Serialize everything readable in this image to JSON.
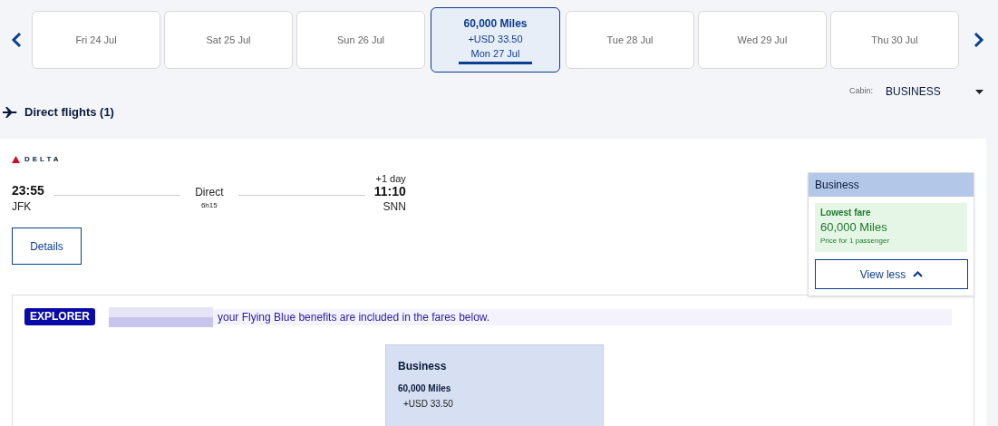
{
  "date_strip": [
    {
      "label": "Fri 24 Jul",
      "selected": false
    },
    {
      "label": "Sat 25 Jul",
      "selected": false
    },
    {
      "label": "Sun 26 Jul",
      "selected": false
    },
    {
      "label": "Mon 27 Jul",
      "price": "60,000 Miles",
      "tax": "+USD 33.50",
      "selected": true
    },
    {
      "label": "Tue 28 Jul",
      "selected": false
    },
    {
      "label": "Wed 29 Jul",
      "selected": false
    },
    {
      "label": "Thu 30 Jul",
      "selected": false
    }
  ],
  "cabin": {
    "label": "Cabin:",
    "value": "BUSINESS"
  },
  "section_title": "Direct flights (1)",
  "flight": {
    "airline": "DELTA",
    "departure_time": "23:55",
    "departure_airport": "JFK",
    "stops": "Direct",
    "duration": "6h15",
    "day_offset": "+1 day",
    "arrival_time": "11:10",
    "arrival_airport": "SNN",
    "details_button": "Details"
  },
  "fare_popup": {
    "cabin": "Business",
    "tag": "Lowest fare",
    "price": "60,000 Miles",
    "note": "Price for 1 passenger",
    "button": "View less"
  },
  "benefits": {
    "badge": "EXPLORER",
    "message": "your Flying Blue benefits are included in the fares below."
  },
  "fare_card": {
    "cabin": "Business",
    "price": "60,000 Miles",
    "tax": "+USD 33.50"
  }
}
